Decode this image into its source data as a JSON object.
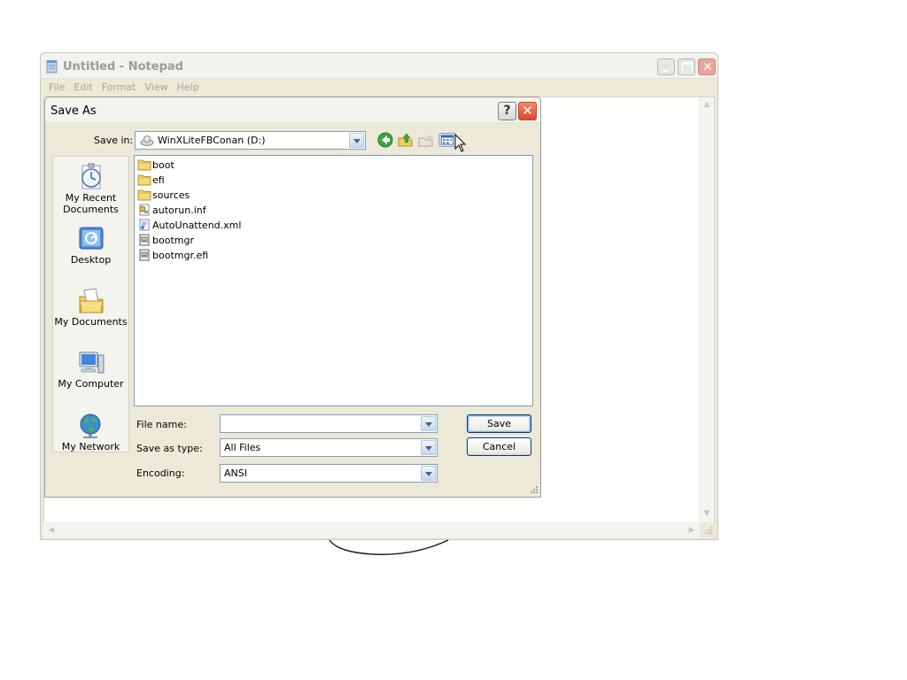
{
  "notepad": {
    "title": "Untitled - Notepad",
    "menu": [
      "File",
      "Edit",
      "Format",
      "View",
      "Help"
    ]
  },
  "dialog": {
    "title": "Save As",
    "help_label": "?",
    "save_in_label": "Save in:",
    "save_in_value": "WinXLiteFBConan (D:)",
    "places": [
      {
        "label": "My Recent Documents",
        "icon": "recent-documents-icon"
      },
      {
        "label": "Desktop",
        "icon": "desktop-icon"
      },
      {
        "label": "My Documents",
        "icon": "my-documents-icon"
      },
      {
        "label": "My Computer",
        "icon": "my-computer-icon"
      },
      {
        "label": "My Network",
        "icon": "my-network-icon"
      }
    ],
    "files": [
      {
        "name": "boot",
        "type": "folder"
      },
      {
        "name": "efi",
        "type": "folder"
      },
      {
        "name": "sources",
        "type": "folder"
      },
      {
        "name": "autorun.inf",
        "type": "inf"
      },
      {
        "name": "AutoUnattend.xml",
        "type": "xml"
      },
      {
        "name": "bootmgr",
        "type": "system"
      },
      {
        "name": "bootmgr.efi",
        "type": "system"
      }
    ],
    "file_name_label": "File name:",
    "file_name_value": "",
    "save_as_type_label": "Save as type:",
    "save_as_type_value": "All Files",
    "encoding_label": "Encoding:",
    "encoding_value": "ANSI",
    "save_button": "Save",
    "cancel_button": "Cancel"
  }
}
